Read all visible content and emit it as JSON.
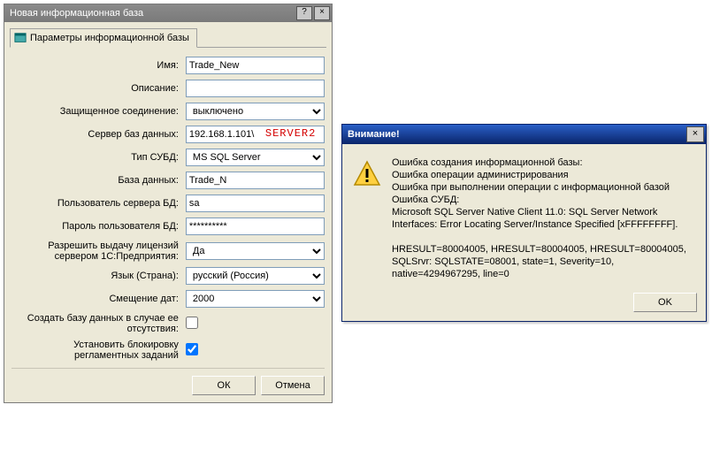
{
  "mainWindow": {
    "title": "Новая информационная база",
    "helpBtn": "?",
    "closeBtn": "×",
    "tabLabel": "Параметры информационной базы",
    "labels": {
      "name": "Имя:",
      "desc": "Описание:",
      "secure": "Защищенное соединение:",
      "dbServer": "Сервер баз данных:",
      "dbType": "Тип СУБД:",
      "dbName": "База данных:",
      "dbUser": "Пользователь сервера БД:",
      "dbPass": "Пароль пользователя БД:",
      "license": "Разрешить выдачу лицензий сервером 1С:Предприятия:",
      "lang": "Язык (Страна):",
      "dateOffset": "Смещение дат:",
      "createIfMissing": "Создать базу данных в случае ее отсутствия:",
      "blockJobs": "Установить блокировку регламентных заданий"
    },
    "values": {
      "name": "Trade_New",
      "desc": "",
      "secure": "выключено",
      "dbServer": "192.168.1.101\\",
      "dbServerOverlay": "SERVER2",
      "dbType": "MS SQL Server",
      "dbName": "Trade_N",
      "dbUser": "sa",
      "dbPass": "**********",
      "license": "Да",
      "lang": "русский (Россия)",
      "dateOffset": "2000",
      "createIfMissing": false,
      "blockJobs": true
    },
    "buttons": {
      "ok": "ОК",
      "cancel": "Отмена"
    }
  },
  "dialog": {
    "title": "Внимание!",
    "closeBtn": "×",
    "text": "Ошибка создания информационной базы:\nОшибка операции администрирования\nОшибка при выполнении операции с информационной базой\nОшибка СУБД:\nMicrosoft SQL Server Native Client 11.0: SQL Server Network Interfaces: Error Locating Server/Instance Specified [xFFFFFFFF].\n\nHRESULT=80004005, HRESULT=80004005, HRESULT=80004005,\nSQLSrvr: SQLSTATE=08001, state=1, Severity=10,\nnative=4294967295, line=0",
    "ok": "OK"
  }
}
